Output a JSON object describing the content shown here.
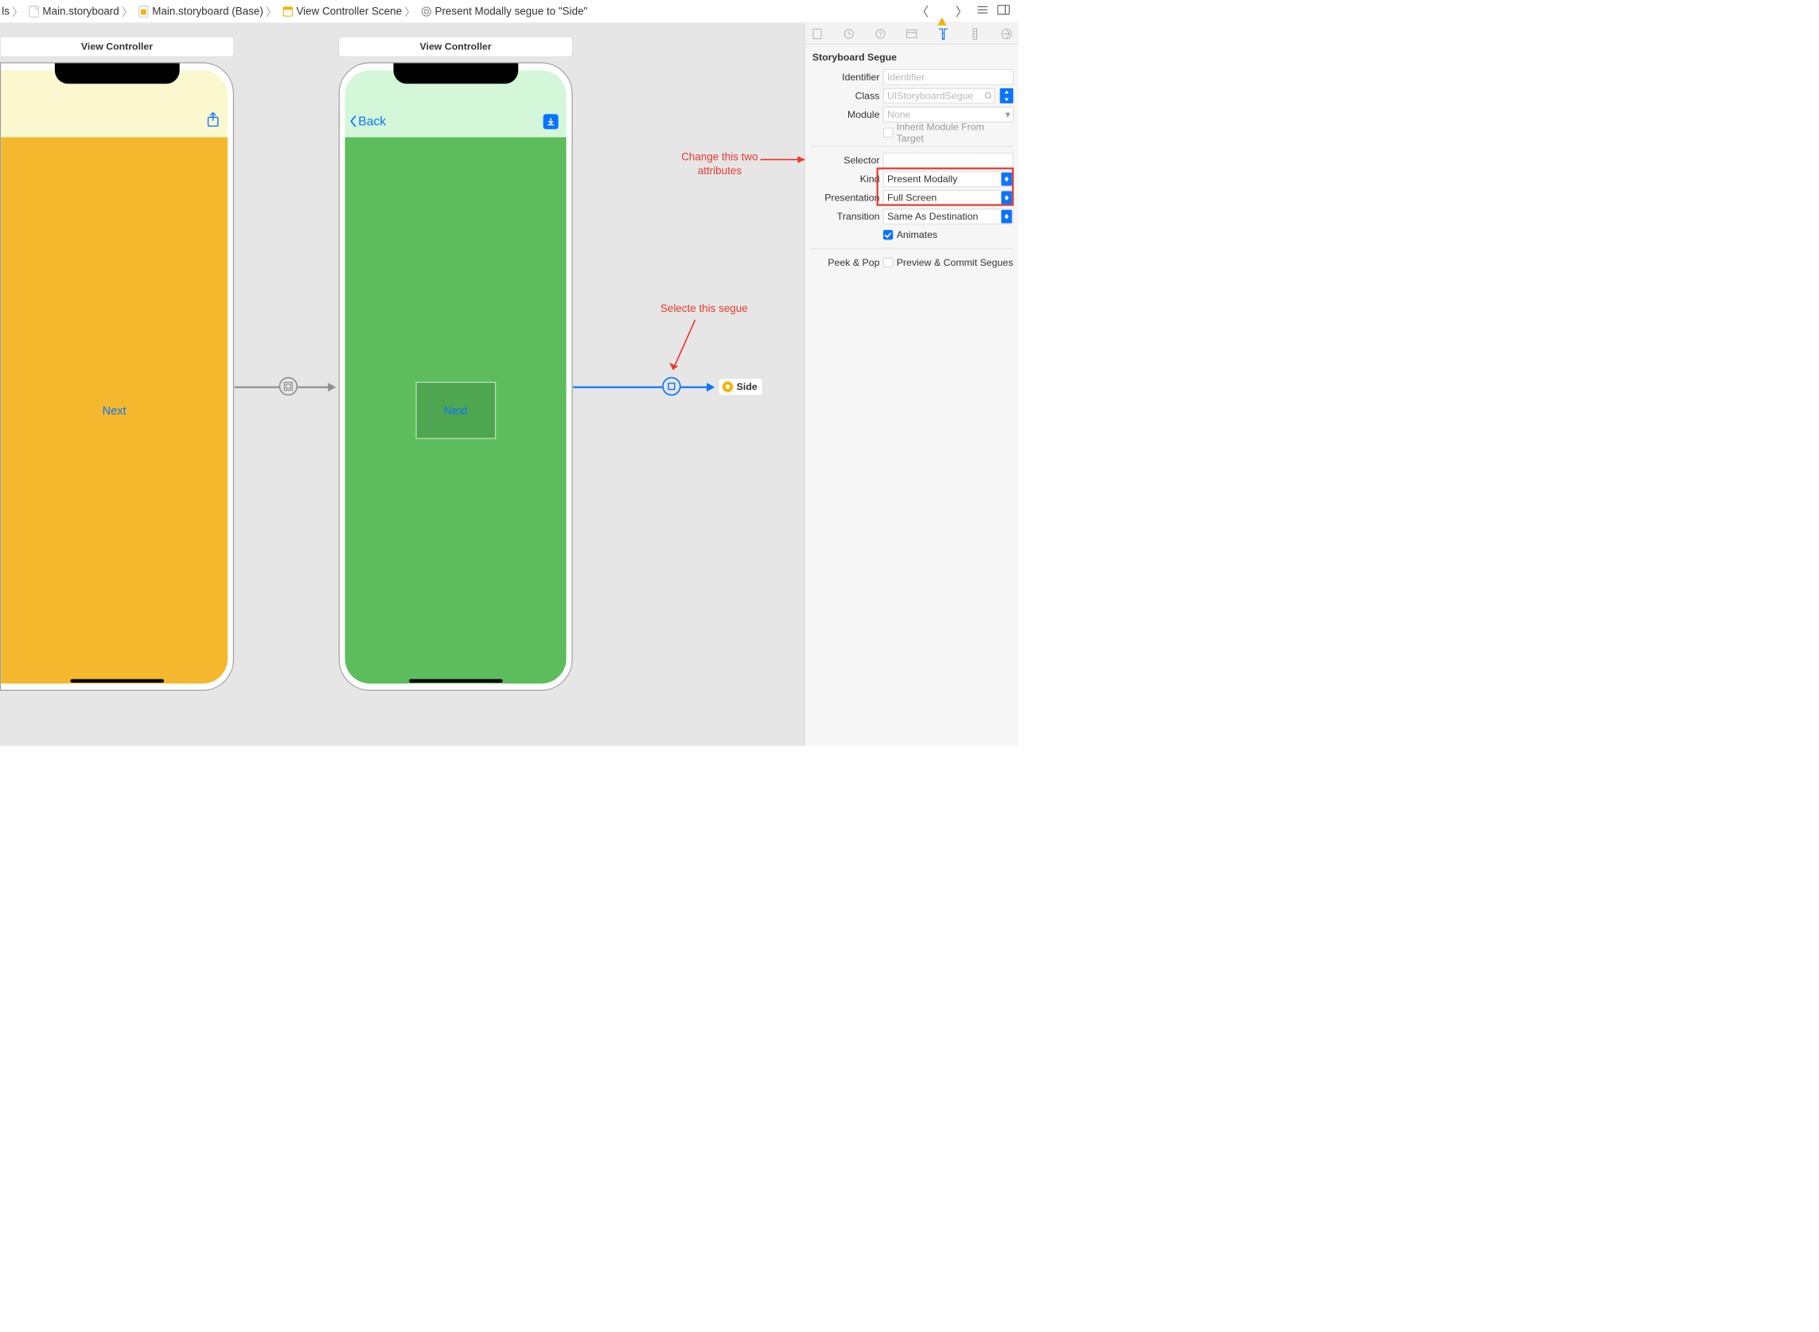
{
  "breadcrumbs": {
    "partial0": "ls",
    "item1": "Main.storyboard",
    "item2": "Main.storyboard (Base)",
    "item3": "View Controller Scene",
    "item4": "Present Modally segue to \"Side\""
  },
  "canvas": {
    "scene1_title": "View Controller",
    "scene1_button": "Next",
    "scene2_title": "View Controller",
    "scene2_back": "Back",
    "scene2_button": "Next",
    "side_chip": "Side"
  },
  "annotations": {
    "select_segue": "Selecte this segue",
    "change_attrs_line1": "Change this two",
    "change_attrs_line2": "attributes"
  },
  "inspector": {
    "section_title": "Storyboard Segue",
    "labels": {
      "identifier": "Identifier",
      "class_": "Class",
      "module": "Module",
      "inherit": "Inherit Module From Target",
      "selector": "Selector",
      "kind": "Kind",
      "presentation": "Presentation",
      "transition": "Transition",
      "animates": "Animates",
      "peekpop": "Peek & Pop",
      "peekpop_value": "Preview & Commit Segues"
    },
    "values": {
      "identifier_placeholder": "Identifier",
      "class_placeholder": "UIStoryboardSegue",
      "module_placeholder": "None",
      "kind": "Present Modally",
      "presentation": "Full Screen",
      "transition": "Same As Destination"
    },
    "checks": {
      "inherit": false,
      "animates": true,
      "peekpop": false
    }
  }
}
